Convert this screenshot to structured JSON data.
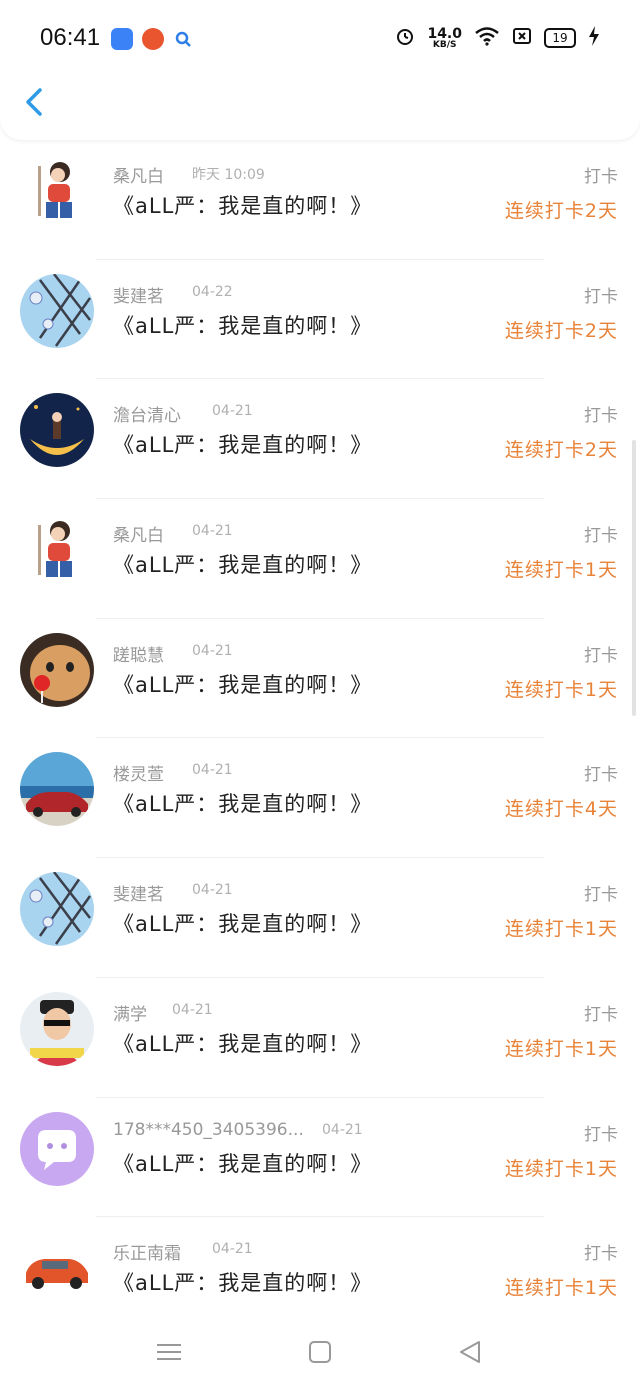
{
  "status_bar": {
    "time": "06:41",
    "speed_value": "14.0",
    "speed_unit": "KB/S",
    "battery": "19"
  },
  "header": {
    "back_icon": "chevron-left-icon"
  },
  "rows": [
    {
      "name": "桑凡白",
      "date": "昨天 10:09",
      "content": "《aLL严：我是直的啊！》",
      "type": "打卡",
      "streak": "连续打卡2天",
      "avatar": "girl"
    },
    {
      "name": "斐建茗",
      "date": "04-22",
      "content": "《aLL严：我是直的啊！》",
      "type": "打卡",
      "streak": "连续打卡2天",
      "avatar": "sky"
    },
    {
      "name": "澹台清心",
      "date": "04-21",
      "content": "《aLL严：我是直的啊！》",
      "type": "打卡",
      "streak": "连续打卡2天",
      "avatar": "moon"
    },
    {
      "name": "桑凡白",
      "date": "04-21",
      "content": "《aLL严：我是直的啊！》",
      "type": "打卡",
      "streak": "连续打卡1天",
      "avatar": "girl"
    },
    {
      "name": "蹉聪慧",
      "date": "04-21",
      "content": "《aLL严：我是直的啊！》",
      "type": "打卡",
      "streak": "连续打卡1天",
      "avatar": "cat"
    },
    {
      "name": "楼灵萱",
      "date": "04-21",
      "content": "《aLL严：我是直的啊！》",
      "type": "打卡",
      "streak": "连续打卡4天",
      "avatar": "car-sea"
    },
    {
      "name": "斐建茗",
      "date": "04-21",
      "content": "《aLL严：我是直的啊！》",
      "type": "打卡",
      "streak": "连续打卡1天",
      "avatar": "sky"
    },
    {
      "name": "满学",
      "date": "04-21",
      "content": "《aLL严：我是直的啊！》",
      "type": "打卡",
      "streak": "连续打卡1天",
      "avatar": "man"
    },
    {
      "name": "178***450_3405396...",
      "date": "04-21",
      "content": "《aLL严：我是直的啊！》",
      "type": "打卡",
      "streak": "连续打卡1天",
      "avatar": "chat"
    },
    {
      "name": "乐正南霜",
      "date": "04-21",
      "content": "《aLL严：我是直的啊！》",
      "type": "打卡",
      "streak": "连续打卡1天",
      "avatar": "orange-car"
    }
  ],
  "nav": {
    "menu_icon": "menu-icon",
    "home_icon": "home-square-icon",
    "back_icon": "triangle-back-icon"
  },
  "colors": {
    "accent": "#e8833a",
    "muted": "#999999",
    "back_arrow": "#2f9be6"
  }
}
